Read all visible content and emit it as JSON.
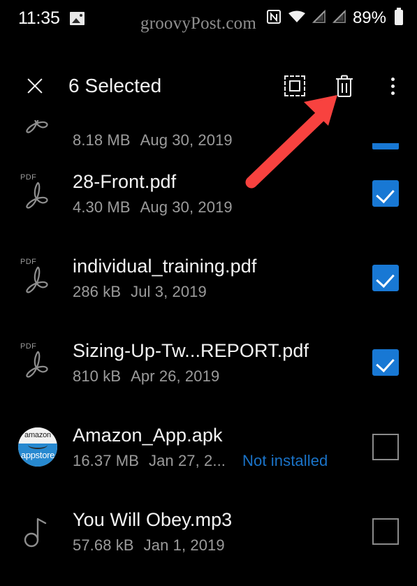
{
  "status_bar": {
    "clock": "11:35",
    "battery_percent": "89%",
    "icons": [
      "photo-icon",
      "nfc-icon",
      "wifi-icon",
      "signal-no-sim-icon",
      "signal-no-sim-icon-2",
      "battery-icon"
    ]
  },
  "watermark": {
    "text": "groovyPost.com"
  },
  "action_bar": {
    "close_label": "close-icon",
    "title": "6 Selected",
    "select_all_label": "select-all-icon",
    "delete_label": "delete-icon",
    "overflow_label": "more-options-icon"
  },
  "annotation": {
    "arrow_color": "#f8423f",
    "points_to": "delete-icon"
  },
  "colors": {
    "background": "#000000",
    "accent_blue": "#1878d4",
    "status_link_blue": "#1a73c8",
    "primary_text": "#f4f4f4",
    "secondary_text": "#9b9b9b",
    "annotation_red": "#f8423f"
  },
  "files": [
    {
      "name": "",
      "size": "8.18 MB",
      "date": "Aug 30, 2019",
      "status": "",
      "icon": "pdf-icon",
      "checked": true,
      "clipped": true
    },
    {
      "name": "28-Front.pdf",
      "size": "4.30 MB",
      "date": "Aug 30, 2019",
      "status": "",
      "icon": "pdf-icon",
      "checked": true,
      "clipped": false
    },
    {
      "name": "individual_training.pdf",
      "size": "286 kB",
      "date": "Jul 3, 2019",
      "status": "",
      "icon": "pdf-icon",
      "checked": true,
      "clipped": false
    },
    {
      "name": "Sizing-Up-Tw...REPORT.pdf",
      "size": "810 kB",
      "date": "Apr 26, 2019",
      "status": "",
      "icon": "pdf-icon",
      "checked": true,
      "clipped": false
    },
    {
      "name": "Amazon_App.apk",
      "size": "16.37 MB",
      "date": "Jan 27, 2...",
      "status": "Not installed",
      "icon": "amazon-appstore-icon",
      "checked": false,
      "clipped": false
    },
    {
      "name": "You Will Obey.mp3",
      "size": "57.68 kB",
      "date": "Jan 1, 2019",
      "status": "",
      "icon": "music-icon",
      "checked": false,
      "clipped": false
    }
  ],
  "amazon_icon": {
    "top_text": "amazon",
    "bottom_text": "appstore"
  },
  "pdf_icon": {
    "label": "PDF"
  }
}
